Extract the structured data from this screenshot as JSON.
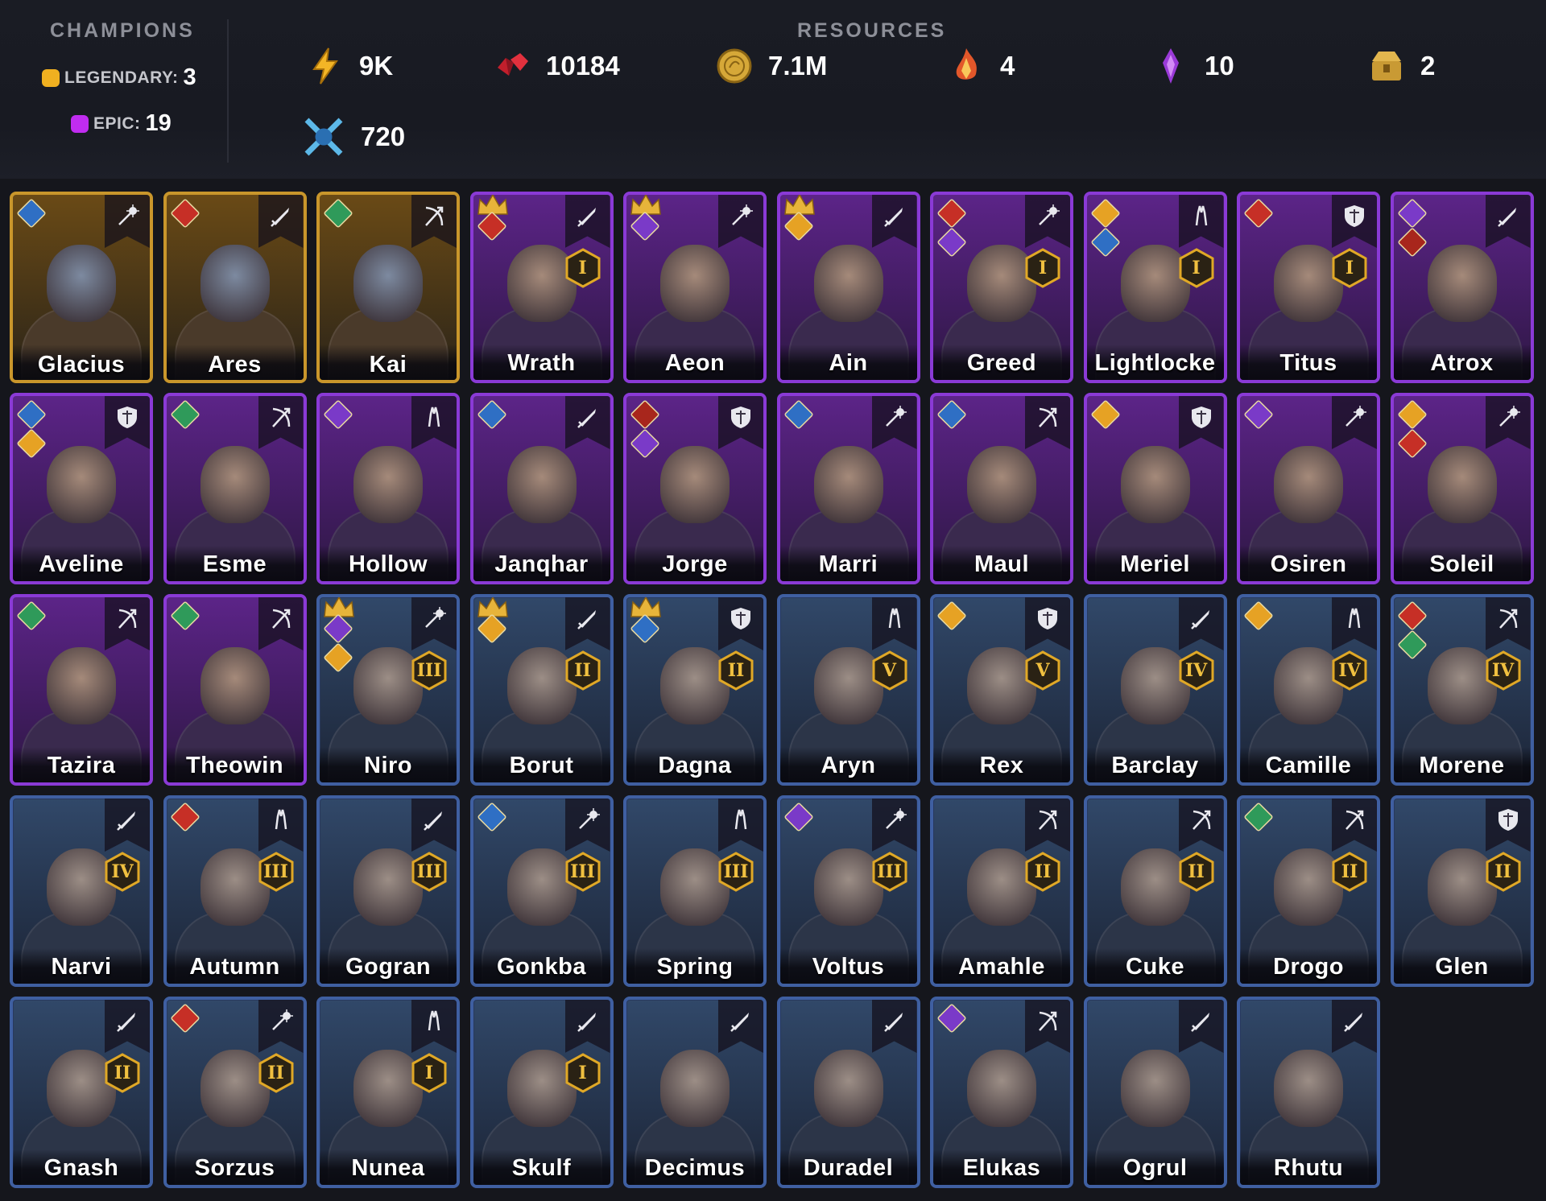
{
  "header": {
    "champions_title": "CHAMPIONS",
    "legendary_label": "LEGENDARY:",
    "legendary_count": "3",
    "epic_label": "EPIC:",
    "epic_count": "19",
    "resources_title": "RESOURCES"
  },
  "resources": [
    {
      "icon": "energy-icon",
      "value": "9K"
    },
    {
      "icon": "rubies-icon",
      "value": "10184"
    },
    {
      "icon": "gold-coin-icon",
      "value": "7.1M"
    },
    {
      "icon": "fire-shard-icon",
      "value": "4"
    },
    {
      "icon": "void-shard-icon",
      "value": "10"
    },
    {
      "icon": "treasure-icon",
      "value": "2"
    },
    {
      "icon": "arena-token-icon",
      "value": "720"
    }
  ],
  "colors": {
    "legendary": "#c9962b",
    "epic": "#8a3ad6",
    "rare": "#3f5fa1",
    "legendary_dot": "#f0b020",
    "epic_dot": "#c02cf0"
  },
  "champions": [
    {
      "name": "Glacius",
      "rarity": "legendary",
      "class": "staff",
      "rank": "",
      "crown": false,
      "affinities": [
        "water"
      ]
    },
    {
      "name": "Ares",
      "rarity": "legendary",
      "class": "sword",
      "rank": "",
      "crown": false,
      "affinities": [
        "fire"
      ]
    },
    {
      "name": "Kai",
      "rarity": "legendary",
      "class": "bow",
      "rank": "",
      "crown": false,
      "affinities": [
        "nature"
      ]
    },
    {
      "name": "Wrath",
      "rarity": "epic",
      "class": "sword",
      "rank": "I",
      "crown": true,
      "affinities": [
        "fire"
      ]
    },
    {
      "name": "Aeon",
      "rarity": "epic",
      "class": "staff",
      "rank": "",
      "crown": true,
      "affinities": [
        "void"
      ]
    },
    {
      "name": "Ain",
      "rarity": "epic",
      "class": "sword",
      "rank": "",
      "crown": true,
      "affinities": [
        "light"
      ]
    },
    {
      "name": "Greed",
      "rarity": "epic",
      "class": "staff",
      "rank": "I",
      "crown": false,
      "affinities": [
        "fire",
        "void"
      ]
    },
    {
      "name": "Lightlocke",
      "rarity": "epic",
      "class": "hands",
      "rank": "I",
      "crown": false,
      "affinities": [
        "light",
        "water"
      ]
    },
    {
      "name": "Titus",
      "rarity": "epic",
      "class": "shield",
      "rank": "I",
      "crown": false,
      "affinities": [
        "fire"
      ]
    },
    {
      "name": "Atrox",
      "rarity": "epic",
      "class": "sword",
      "rank": "",
      "crown": false,
      "affinities": [
        "void",
        "chaos"
      ]
    },
    {
      "name": "Aveline",
      "rarity": "epic",
      "class": "shield",
      "rank": "",
      "crown": false,
      "affinities": [
        "water",
        "light"
      ]
    },
    {
      "name": "Esme",
      "rarity": "epic",
      "class": "bow",
      "rank": "",
      "crown": false,
      "affinities": [
        "nature"
      ]
    },
    {
      "name": "Hollow",
      "rarity": "epic",
      "class": "hands",
      "rank": "",
      "crown": false,
      "affinities": [
        "void"
      ]
    },
    {
      "name": "Janqhar",
      "rarity": "epic",
      "class": "sword",
      "rank": "",
      "crown": false,
      "affinities": [
        "water"
      ]
    },
    {
      "name": "Jorge",
      "rarity": "epic",
      "class": "shield",
      "rank": "",
      "crown": false,
      "affinities": [
        "chaos",
        "void"
      ]
    },
    {
      "name": "Marri",
      "rarity": "epic",
      "class": "staff",
      "rank": "",
      "crown": false,
      "affinities": [
        "water"
      ]
    },
    {
      "name": "Maul",
      "rarity": "epic",
      "class": "bow",
      "rank": "",
      "crown": false,
      "affinities": [
        "water"
      ]
    },
    {
      "name": "Meriel",
      "rarity": "epic",
      "class": "shield",
      "rank": "",
      "crown": false,
      "affinities": [
        "light"
      ]
    },
    {
      "name": "Osiren",
      "rarity": "epic",
      "class": "staff",
      "rank": "",
      "crown": false,
      "affinities": [
        "void"
      ]
    },
    {
      "name": "Soleil",
      "rarity": "epic",
      "class": "staff",
      "rank": "",
      "crown": false,
      "affinities": [
        "light",
        "fire"
      ]
    },
    {
      "name": "Tazira",
      "rarity": "epic",
      "class": "bow",
      "rank": "",
      "crown": false,
      "affinities": [
        "nature"
      ]
    },
    {
      "name": "Theowin",
      "rarity": "epic",
      "class": "bow",
      "rank": "",
      "crown": false,
      "affinities": [
        "nature"
      ]
    },
    {
      "name": "Niro",
      "rarity": "rare",
      "class": "staff",
      "rank": "III",
      "crown": true,
      "affinities": [
        "void",
        "light"
      ]
    },
    {
      "name": "Borut",
      "rarity": "rare",
      "class": "sword",
      "rank": "II",
      "crown": true,
      "affinities": [
        "light"
      ]
    },
    {
      "name": "Dagna",
      "rarity": "rare",
      "class": "shield",
      "rank": "II",
      "crown": true,
      "affinities": [
        "water"
      ]
    },
    {
      "name": "Aryn",
      "rarity": "rare",
      "class": "hands",
      "rank": "V",
      "crown": false,
      "affinities": []
    },
    {
      "name": "Rex",
      "rarity": "rare",
      "class": "shield",
      "rank": "V",
      "crown": false,
      "affinities": [
        "light"
      ]
    },
    {
      "name": "Barclay",
      "rarity": "rare",
      "class": "sword",
      "rank": "IV",
      "crown": false,
      "affinities": []
    },
    {
      "name": "Camille",
      "rarity": "rare",
      "class": "hands",
      "rank": "IV",
      "crown": false,
      "affinities": [
        "light"
      ]
    },
    {
      "name": "Morene",
      "rarity": "rare",
      "class": "bow",
      "rank": "IV",
      "crown": false,
      "affinities": [
        "fire",
        "nature"
      ]
    },
    {
      "name": "Narvi",
      "rarity": "rare",
      "class": "sword",
      "rank": "IV",
      "crown": false,
      "affinities": []
    },
    {
      "name": "Autumn",
      "rarity": "rare",
      "class": "hands",
      "rank": "III",
      "crown": false,
      "affinities": [
        "fire"
      ]
    },
    {
      "name": "Gogran",
      "rarity": "rare",
      "class": "sword",
      "rank": "III",
      "crown": false,
      "affinities": []
    },
    {
      "name": "Gonkba",
      "rarity": "rare",
      "class": "staff",
      "rank": "III",
      "crown": false,
      "affinities": [
        "water"
      ]
    },
    {
      "name": "Spring",
      "rarity": "rare",
      "class": "hands",
      "rank": "III",
      "crown": false,
      "affinities": []
    },
    {
      "name": "Voltus",
      "rarity": "rare",
      "class": "staff",
      "rank": "III",
      "crown": false,
      "affinities": [
        "void"
      ]
    },
    {
      "name": "Amahle",
      "rarity": "rare",
      "class": "bow",
      "rank": "II",
      "crown": false,
      "affinities": []
    },
    {
      "name": "Cuke",
      "rarity": "rare",
      "class": "bow",
      "rank": "II",
      "crown": false,
      "affinities": []
    },
    {
      "name": "Drogo",
      "rarity": "rare",
      "class": "bow",
      "rank": "II",
      "crown": false,
      "affinities": [
        "nature"
      ]
    },
    {
      "name": "Glen",
      "rarity": "rare",
      "class": "shield",
      "rank": "II",
      "crown": false,
      "affinities": []
    },
    {
      "name": "Gnash",
      "rarity": "rare",
      "class": "sword",
      "rank": "II",
      "crown": false,
      "affinities": []
    },
    {
      "name": "Sorzus",
      "rarity": "rare",
      "class": "staff",
      "rank": "II",
      "crown": false,
      "affinities": [
        "fire"
      ]
    },
    {
      "name": "Nunea",
      "rarity": "rare",
      "class": "hands",
      "rank": "I",
      "crown": false,
      "affinities": []
    },
    {
      "name": "Skulf",
      "rarity": "rare",
      "class": "sword",
      "rank": "I",
      "crown": false,
      "affinities": []
    },
    {
      "name": "Decimus",
      "rarity": "rare",
      "class": "sword",
      "rank": "",
      "crown": false,
      "affinities": []
    },
    {
      "name": "Duradel",
      "rarity": "rare",
      "class": "sword",
      "rank": "",
      "crown": false,
      "affinities": []
    },
    {
      "name": "Elukas",
      "rarity": "rare",
      "class": "bow",
      "rank": "",
      "crown": false,
      "affinities": [
        "void"
      ]
    },
    {
      "name": "Ogrul",
      "rarity": "rare",
      "class": "sword",
      "rank": "",
      "crown": false,
      "affinities": []
    },
    {
      "name": "Rhutu",
      "rarity": "rare",
      "class": "sword",
      "rank": "",
      "crown": false,
      "affinities": []
    }
  ]
}
